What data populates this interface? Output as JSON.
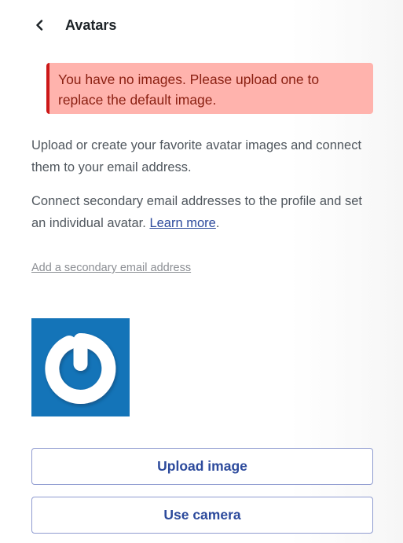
{
  "header": {
    "back_icon": "chevron-left-icon",
    "title": "Avatars"
  },
  "notice": {
    "text": "You have no images. Please upload one to replace the default image.",
    "colors": {
      "background": "#ffb3ad",
      "border": "#cc1818",
      "text": "#8a1f11"
    }
  },
  "intro": {
    "paragraph1": "Upload or create your favorite avatar images and connect them to your email address.",
    "paragraph2_prefix": "Connect secondary email addresses to the profile and set an individual avatar. ",
    "learn_more_label": "Learn more",
    "paragraph2_suffix": "."
  },
  "secondary_email_link": "Add a secondary email address",
  "avatar": {
    "icon": "gravatar-logo-icon",
    "background": "#1474b8"
  },
  "actions": {
    "upload_label": "Upload image",
    "camera_label": "Use camera",
    "accent": "#2c4a9c"
  }
}
